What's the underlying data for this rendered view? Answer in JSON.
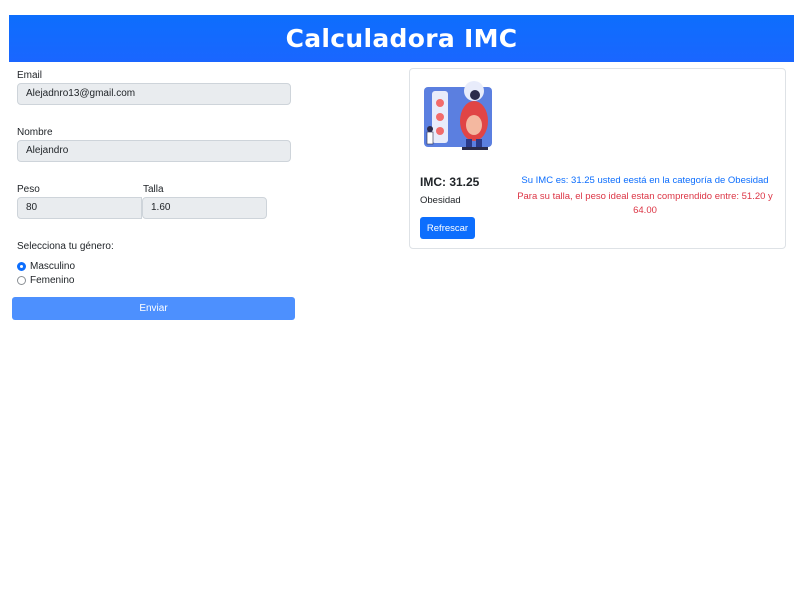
{
  "header": {
    "title": "Calculadora IMC"
  },
  "form": {
    "email_label": "Email",
    "email_value": "Alejadnro13@gmail.com",
    "nombre_label": "Nombre",
    "nombre_value": "Alejandro",
    "peso_label": "Peso",
    "peso_value": "80",
    "talla_label": "Talla",
    "talla_value": "1.60",
    "gender_prompt": "Selecciona tu género:",
    "gender_options": [
      {
        "label": "Masculino",
        "checked": true
      },
      {
        "label": "Femenino",
        "checked": false
      }
    ],
    "submit_label": "Enviar"
  },
  "result": {
    "imc_text": "IMC: 31.25",
    "category": "Obesidad",
    "refresh_label": "Refrescar",
    "message_imc": "Su IMC es: 31.25 usted eestá en la categoría de Obesidad",
    "message_ideal": "Para su talla, el peso ideal estan comprendido entre: 51.20 y 64.00"
  },
  "colors": {
    "primary": "#0d6efd",
    "danger": "#dc3545",
    "submit": "#4d90fe"
  },
  "icons": {
    "illustration": "obesity-scale-illustration"
  }
}
